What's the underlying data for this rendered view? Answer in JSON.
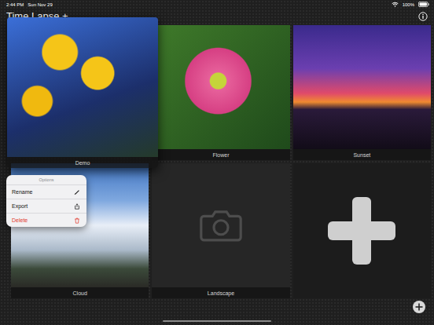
{
  "status_bar": {
    "time": "2:44 PM",
    "date": "Sun Nov 29",
    "battery": "100%"
  },
  "title": "Time Lapse +",
  "projects": [
    {
      "name": "Demo",
      "kind": "photo",
      "selected": true
    },
    {
      "name": "Flower",
      "kind": "photo",
      "selected": false
    },
    {
      "name": "Sunset",
      "kind": "photo",
      "selected": false
    },
    {
      "name": "Cloud",
      "kind": "photo",
      "selected": false
    },
    {
      "name": "Landscape",
      "kind": "empty",
      "selected": false
    }
  ],
  "context_menu": {
    "title": "Options",
    "items": [
      {
        "label": "Rename",
        "kind": "rename",
        "destructive": false
      },
      {
        "label": "Export",
        "kind": "export",
        "destructive": false
      },
      {
        "label": "Delete",
        "kind": "delete",
        "destructive": true
      }
    ]
  }
}
